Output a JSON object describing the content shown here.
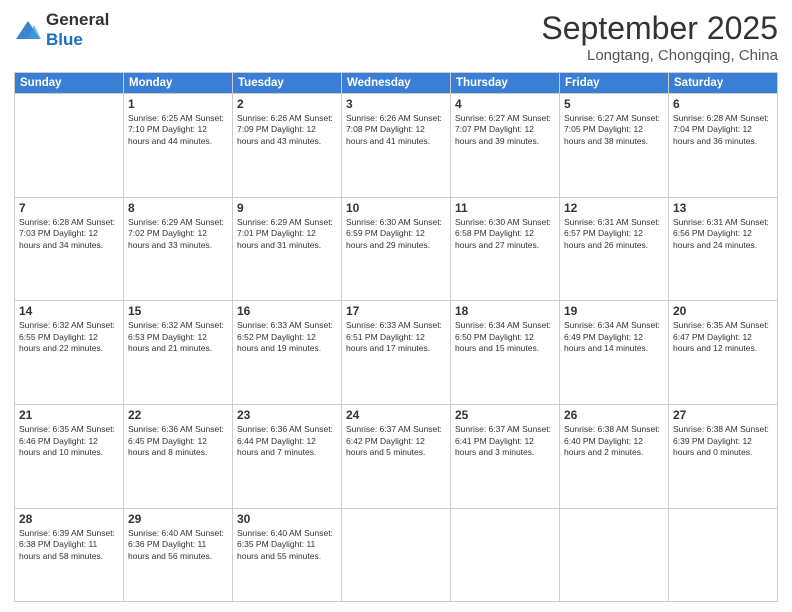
{
  "logo": {
    "general": "General",
    "blue": "Blue"
  },
  "header": {
    "month": "September 2025",
    "location": "Longtang, Chongqing, China"
  },
  "weekdays": [
    "Sunday",
    "Monday",
    "Tuesday",
    "Wednesday",
    "Thursday",
    "Friday",
    "Saturday"
  ],
  "weeks": [
    [
      {
        "day": "",
        "info": ""
      },
      {
        "day": "1",
        "info": "Sunrise: 6:25 AM\nSunset: 7:10 PM\nDaylight: 12 hours\nand 44 minutes."
      },
      {
        "day": "2",
        "info": "Sunrise: 6:26 AM\nSunset: 7:09 PM\nDaylight: 12 hours\nand 43 minutes."
      },
      {
        "day": "3",
        "info": "Sunrise: 6:26 AM\nSunset: 7:08 PM\nDaylight: 12 hours\nand 41 minutes."
      },
      {
        "day": "4",
        "info": "Sunrise: 6:27 AM\nSunset: 7:07 PM\nDaylight: 12 hours\nand 39 minutes."
      },
      {
        "day": "5",
        "info": "Sunrise: 6:27 AM\nSunset: 7:05 PM\nDaylight: 12 hours\nand 38 minutes."
      },
      {
        "day": "6",
        "info": "Sunrise: 6:28 AM\nSunset: 7:04 PM\nDaylight: 12 hours\nand 36 minutes."
      }
    ],
    [
      {
        "day": "7",
        "info": "Sunrise: 6:28 AM\nSunset: 7:03 PM\nDaylight: 12 hours\nand 34 minutes."
      },
      {
        "day": "8",
        "info": "Sunrise: 6:29 AM\nSunset: 7:02 PM\nDaylight: 12 hours\nand 33 minutes."
      },
      {
        "day": "9",
        "info": "Sunrise: 6:29 AM\nSunset: 7:01 PM\nDaylight: 12 hours\nand 31 minutes."
      },
      {
        "day": "10",
        "info": "Sunrise: 6:30 AM\nSunset: 6:59 PM\nDaylight: 12 hours\nand 29 minutes."
      },
      {
        "day": "11",
        "info": "Sunrise: 6:30 AM\nSunset: 6:58 PM\nDaylight: 12 hours\nand 27 minutes."
      },
      {
        "day": "12",
        "info": "Sunrise: 6:31 AM\nSunset: 6:57 PM\nDaylight: 12 hours\nand 26 minutes."
      },
      {
        "day": "13",
        "info": "Sunrise: 6:31 AM\nSunset: 6:56 PM\nDaylight: 12 hours\nand 24 minutes."
      }
    ],
    [
      {
        "day": "14",
        "info": "Sunrise: 6:32 AM\nSunset: 6:55 PM\nDaylight: 12 hours\nand 22 minutes."
      },
      {
        "day": "15",
        "info": "Sunrise: 6:32 AM\nSunset: 6:53 PM\nDaylight: 12 hours\nand 21 minutes."
      },
      {
        "day": "16",
        "info": "Sunrise: 6:33 AM\nSunset: 6:52 PM\nDaylight: 12 hours\nand 19 minutes."
      },
      {
        "day": "17",
        "info": "Sunrise: 6:33 AM\nSunset: 6:51 PM\nDaylight: 12 hours\nand 17 minutes."
      },
      {
        "day": "18",
        "info": "Sunrise: 6:34 AM\nSunset: 6:50 PM\nDaylight: 12 hours\nand 15 minutes."
      },
      {
        "day": "19",
        "info": "Sunrise: 6:34 AM\nSunset: 6:49 PM\nDaylight: 12 hours\nand 14 minutes."
      },
      {
        "day": "20",
        "info": "Sunrise: 6:35 AM\nSunset: 6:47 PM\nDaylight: 12 hours\nand 12 minutes."
      }
    ],
    [
      {
        "day": "21",
        "info": "Sunrise: 6:35 AM\nSunset: 6:46 PM\nDaylight: 12 hours\nand 10 minutes."
      },
      {
        "day": "22",
        "info": "Sunrise: 6:36 AM\nSunset: 6:45 PM\nDaylight: 12 hours\nand 8 minutes."
      },
      {
        "day": "23",
        "info": "Sunrise: 6:36 AM\nSunset: 6:44 PM\nDaylight: 12 hours\nand 7 minutes."
      },
      {
        "day": "24",
        "info": "Sunrise: 6:37 AM\nSunset: 6:42 PM\nDaylight: 12 hours\nand 5 minutes."
      },
      {
        "day": "25",
        "info": "Sunrise: 6:37 AM\nSunset: 6:41 PM\nDaylight: 12 hours\nand 3 minutes."
      },
      {
        "day": "26",
        "info": "Sunrise: 6:38 AM\nSunset: 6:40 PM\nDaylight: 12 hours\nand 2 minutes."
      },
      {
        "day": "27",
        "info": "Sunrise: 6:38 AM\nSunset: 6:39 PM\nDaylight: 12 hours\nand 0 minutes."
      }
    ],
    [
      {
        "day": "28",
        "info": "Sunrise: 6:39 AM\nSunset: 6:38 PM\nDaylight: 11 hours\nand 58 minutes."
      },
      {
        "day": "29",
        "info": "Sunrise: 6:40 AM\nSunset: 6:36 PM\nDaylight: 11 hours\nand 56 minutes."
      },
      {
        "day": "30",
        "info": "Sunrise: 6:40 AM\nSunset: 6:35 PM\nDaylight: 11 hours\nand 55 minutes."
      },
      {
        "day": "",
        "info": ""
      },
      {
        "day": "",
        "info": ""
      },
      {
        "day": "",
        "info": ""
      },
      {
        "day": "",
        "info": ""
      }
    ]
  ]
}
